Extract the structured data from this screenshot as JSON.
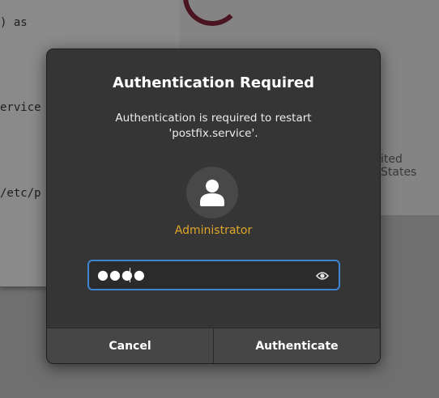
{
  "background": {
    "terminal_lines": [
      ") as",
      "ervice",
      "/etc/p"
    ],
    "settings_fragment": "ited States"
  },
  "dialog": {
    "title": "Authentication Required",
    "message_line1": "Authentication is required to restart",
    "message_line2": "'postfix.service'.",
    "user_name": "Administrator",
    "password_mask": "●●●●",
    "cancel_label": "Cancel",
    "authenticate_label": "Authenticate",
    "colors": {
      "accent": "#3f83d4",
      "user_name": "#e0a629",
      "dialog_bg": "#353535"
    },
    "icons": [
      "avatar-icon",
      "eye-icon"
    ]
  }
}
